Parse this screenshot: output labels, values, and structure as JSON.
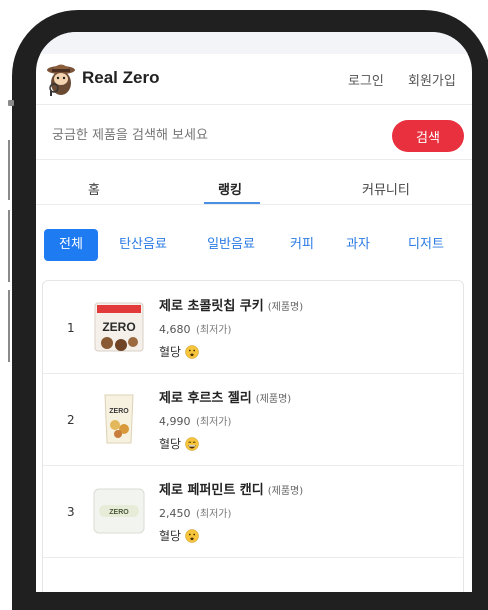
{
  "app": {
    "brand": "Real Zero"
  },
  "header": {
    "login": "로그인",
    "signup": "회원가입"
  },
  "search": {
    "placeholder": "궁금한 제품을 검색해 보세요",
    "button": "검색"
  },
  "tabs": [
    {
      "label": "홈",
      "active": false
    },
    {
      "label": "랭킹",
      "active": true
    },
    {
      "label": "커뮤니티",
      "active": false
    }
  ],
  "categories": [
    {
      "label": "전체",
      "active": true
    },
    {
      "label": "탄산음료",
      "active": false
    },
    {
      "label": "일반음료",
      "active": false
    },
    {
      "label": "커피",
      "active": false
    },
    {
      "label": "과자",
      "active": false
    },
    {
      "label": "디저트",
      "active": false
    }
  ],
  "products": [
    {
      "rank": "1",
      "name": "제로 초콜릿칩 쿠키",
      "tag": "(제품명)",
      "price": "4,680",
      "price_label": "(최저가)",
      "sugar": "혈당",
      "face": "worried"
    },
    {
      "rank": "2",
      "name": "제로 후르츠 젤리",
      "tag": "(제품명)",
      "price": "4,990",
      "price_label": "(최저가)",
      "sugar": "혈당",
      "face": "grin"
    },
    {
      "rank": "3",
      "name": "제로 페퍼민트 캔디",
      "tag": "(제품명)",
      "price": "2,450",
      "price_label": "(최저가)",
      "sugar": "혈당",
      "face": "worried"
    }
  ],
  "colors": {
    "accent": "#1f7bf2",
    "search_button": "#e8303f",
    "tab_underline": "#4a90e2",
    "frame": "#202020"
  }
}
